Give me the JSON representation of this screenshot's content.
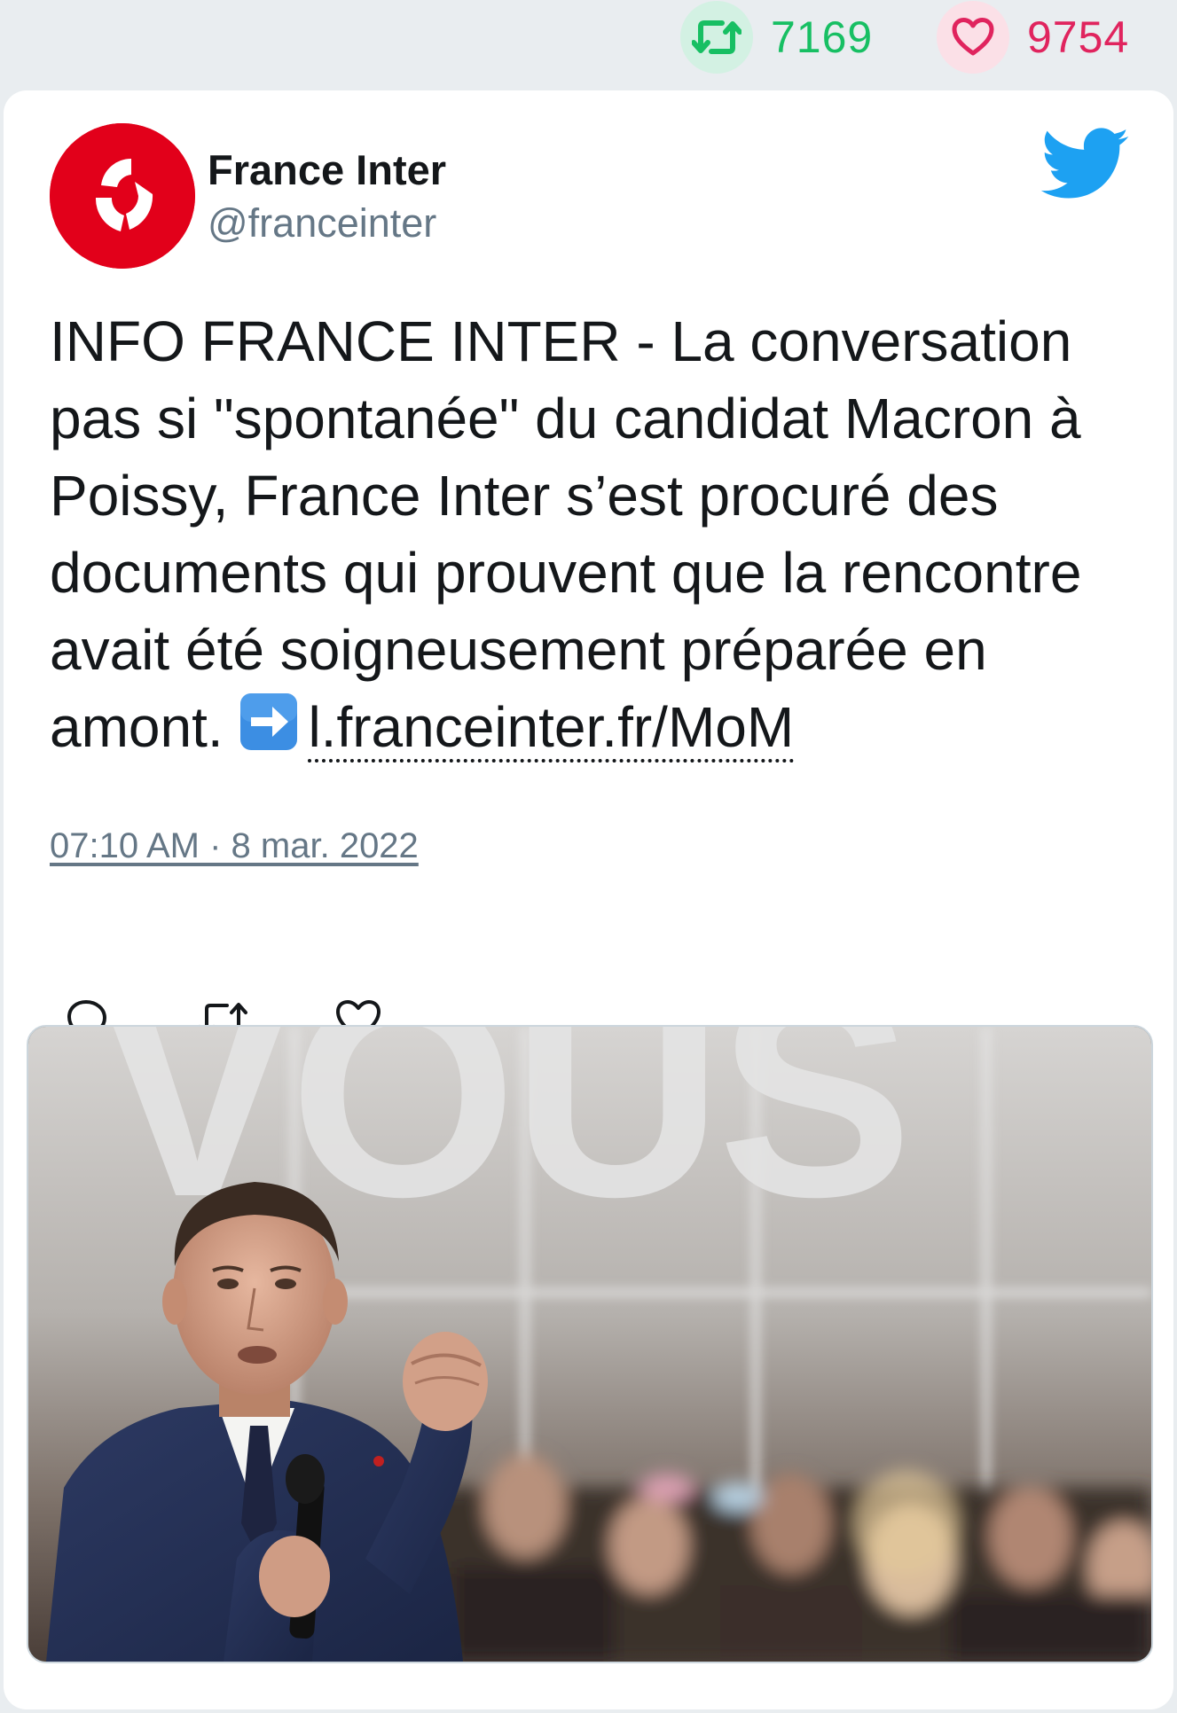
{
  "stats": {
    "retweets": "7169",
    "likes": "9754",
    "colors": {
      "retweet": "#17bf63",
      "like": "#e0245e"
    }
  },
  "tweet": {
    "author": {
      "name": "France Inter",
      "handle": "@franceinter",
      "avatar_color": "#e2001a"
    },
    "text_main": "INFO FRANCE INTER - La conversation pas si \"spontanée\" du candidat Macron à Poissy, France Inter s’est procuré des documents qui prouvent que la rencontre avait été soigneusement préparée en amont.",
    "link": "l.franceinter.fr/MoM",
    "timestamp": "07:10 AM · 8 mar. 2022",
    "icons": {
      "brand": "twitter-bird-icon",
      "arrow": "right-arrow-emoji-icon",
      "reply": "reply-icon",
      "retweet": "retweet-icon",
      "like": "heart-icon"
    },
    "media": {
      "backdrop_word": "VOUS"
    }
  }
}
